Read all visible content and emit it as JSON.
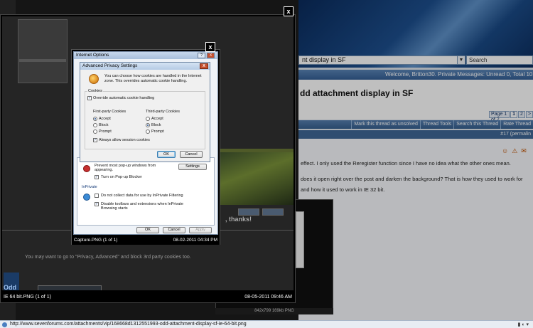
{
  "forum": {
    "thread_title_bar": "nt display in SF",
    "search_placeholder": "Search",
    "welcome_text": "Welcome, Britton30.  Private Messages: Unread 0, Total 10.",
    "thread_title": "dd attachment display in SF",
    "pagination": {
      "label": "Page 1 of 2",
      "pages": [
        "1",
        "2"
      ],
      "next": ">"
    },
    "toolbar": [
      "Mark this thread as unsolved",
      "Thread Tools",
      "Search this Thread",
      "Rate Thread"
    ],
    "post_number": "#17 (permalin",
    "post_lines": [
      "effect. I only used the Reregister function since I have no idea what the other ones mean.",
      "does it open right over the post and darken the background? That is how they used to work for",
      "and how it used to work in IE 32 bit."
    ],
    "image_caption": "842x799  169kb  PNG",
    "ghost_reply": "You may want to go to \"Privacy, Advanced\" and block 3rd party cookies too.",
    "ghost_thanks": ", thanks!"
  },
  "lightbox_outer": {
    "caption": "IE 64 bit.PNG (1 of 1)",
    "timestamp": "08-05-2011 09:46 AM",
    "close_label": "x"
  },
  "lightbox_inner": {
    "caption": "Capture.PNG (1 of 1)",
    "timestamp": "08-02-2011 04:34 PM",
    "close_label": "x"
  },
  "internet_options": {
    "title": "Internet Options",
    "help": "?",
    "close": "X",
    "popup_text": "Prevent most pop-up windows from appearing.",
    "settings_label": "Settings",
    "popup_blocker": "Turn on Pop-up Blocker",
    "inprivate_heading": "InPrivate",
    "inprivate_filter": "Do not collect data for use by InPrivate Filtering",
    "inprivate_toolbars": "Disable toolbars and extensions when InPrivate Browsing starts",
    "ok": "OK",
    "cancel": "Cancel",
    "apply": "Apply"
  },
  "advanced_privacy": {
    "title": "Advanced Privacy Settings",
    "close": "X",
    "intro": "You can choose how cookies are handled in the Internet zone.  This overrides automatic cookie handling.",
    "cookies_label": "Cookies",
    "override_label": "Override automatic cookie handling",
    "first_party_label": "First-party Cookies",
    "third_party_label": "Third-party Cookies",
    "options": [
      "Accept",
      "Block",
      "Prompt"
    ],
    "first_party_selected": "Accept",
    "third_party_selected": "Block",
    "session_label": "Always allow session cookies",
    "ok": "OK",
    "cancel": "Cancel"
  },
  "statusbar": {
    "url": "http://www.sevenforums.com/attachments/vip/168668d1312551993-odd-attachment-display-sf-ie-64-bit.png"
  }
}
